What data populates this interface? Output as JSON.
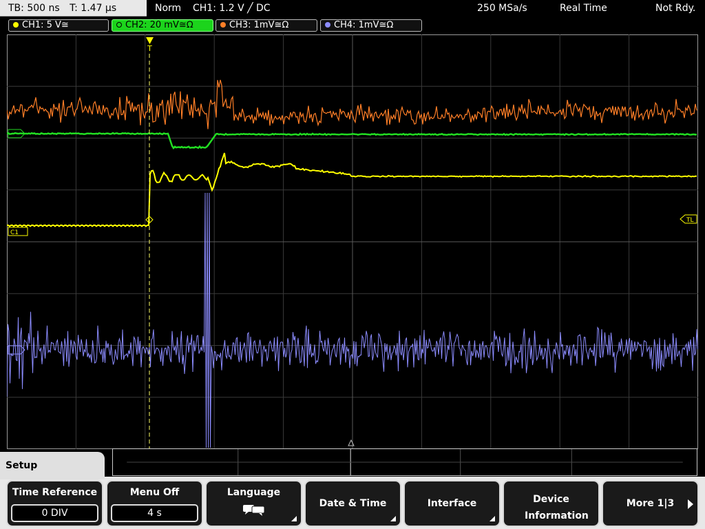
{
  "status": {
    "tb_label": "TB: 500 ns",
    "t_label": "T: 1.47 µs",
    "mode": "Norm",
    "trigger": "CH1: 1.2 V ╱ DC",
    "sample_rate": "250 MSa/s",
    "acq_mode": "Real Time",
    "trigger_status": "Not Rdy."
  },
  "channels": [
    {
      "label": "CH1: 5 V≅",
      "color": "#ffff00"
    },
    {
      "label": "CH2: 20 mV≅Ω",
      "color": "#22dd22"
    },
    {
      "label": "CH3: 1mV≅Ω",
      "color": "#ff7f27"
    },
    {
      "label": "CH4: 1mV≅Ω",
      "color": "#8c8cff"
    }
  ],
  "markers": {
    "ch1": "C1",
    "tl": "TL",
    "trigger_pos": "T"
  },
  "menu": {
    "title": "Setup",
    "keys": [
      {
        "label": "Time Reference",
        "value": "0 DIV"
      },
      {
        "label": "Menu Off",
        "value": "4 s"
      },
      {
        "label": "Language",
        "icon": "speech-bubbles-icon"
      },
      {
        "label": "Date & Time"
      },
      {
        "label": "Interface"
      },
      {
        "label": "Device Information"
      },
      {
        "label": "More 1|3"
      }
    ]
  }
}
